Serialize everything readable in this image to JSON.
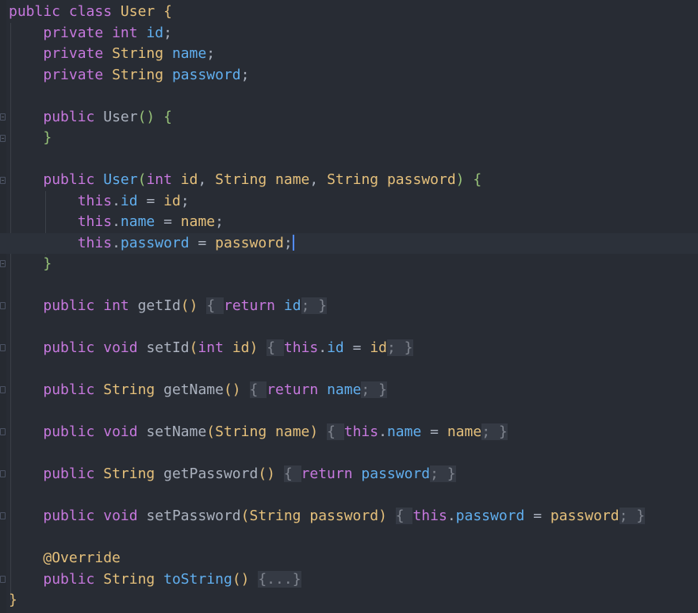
{
  "editor": {
    "lines": [
      "public class User {",
      "    private int id;",
      "    private String name;",
      "    private String password;",
      "",
      "    public User() {",
      "    }",
      "",
      "    public User(int id, String name, String password) {",
      "        this.id = id;",
      "        this.name = name;",
      "        this.password = password;",
      "    }",
      "",
      "    public int getId() { return id; }",
      "",
      "    public void setId(int id) { this.id = id; }",
      "",
      "    public String getName() { return name; }",
      "",
      "    public void setName(String name) { this.name = name; }",
      "",
      "    public String getPassword() { return password; }",
      "",
      "    public void setPassword(String password) { this.password = password; }",
      "",
      "    @Override",
      "    public String toString() {...}",
      "}"
    ],
    "tokens": {
      "public": "public",
      "private": "private",
      "class": "class",
      "int": "int",
      "void": "void",
      "String": "String",
      "User": "User",
      "this": "this",
      "return": "return",
      "id": "id",
      "name": "name",
      "password": "password",
      "getId": "getId",
      "setId": "setId",
      "getName": "getName",
      "setName": "setName",
      "getPassword": "getPassword",
      "setPassword": "setPassword",
      "toString": "toString",
      "override": "@Override",
      "folded_body": "{...}"
    },
    "caret_line": 12,
    "colors": {
      "background": "#282c34",
      "keyword": "#c678dd",
      "type": "#e5c07b",
      "field": "#61afef",
      "default": "#abb2bf",
      "caret": "#528bff"
    }
  }
}
